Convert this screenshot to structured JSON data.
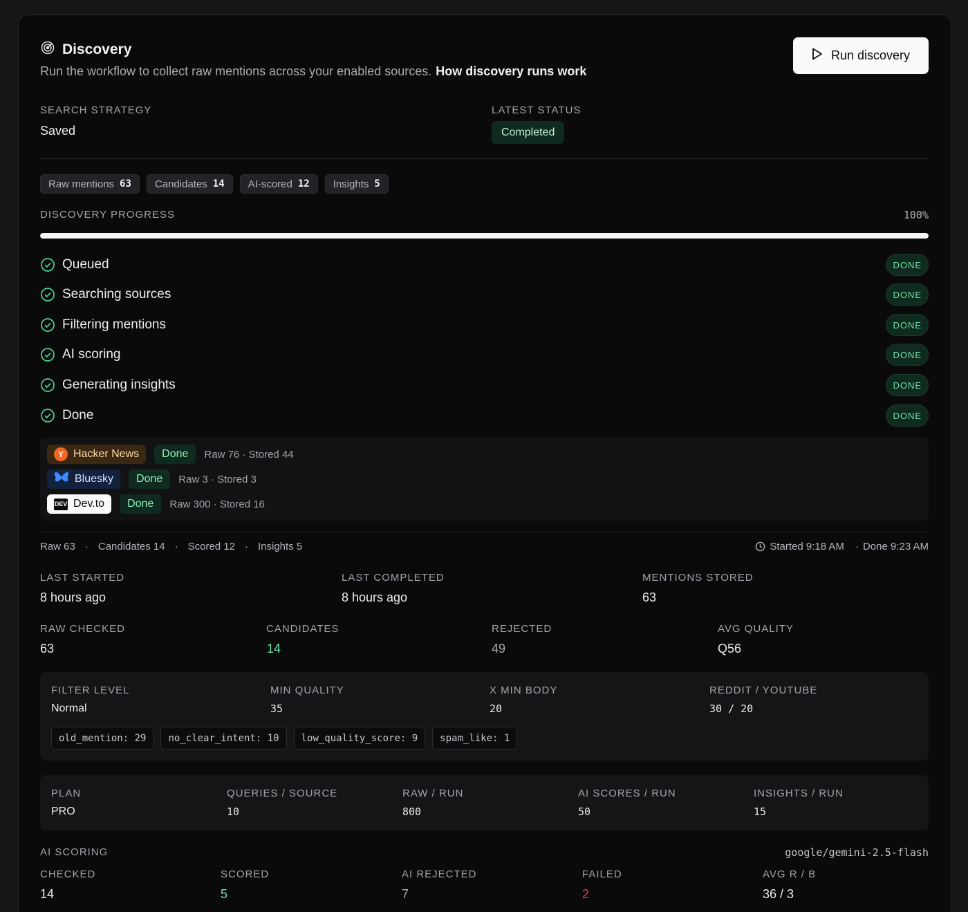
{
  "header": {
    "title": "Discovery",
    "subtitle": "Run the workflow to collect raw mentions across your enabled sources.",
    "help_link": "How discovery runs work",
    "run_button": "Run discovery"
  },
  "strategy": {
    "label": "SEARCH STRATEGY",
    "value": "Saved"
  },
  "latest_status": {
    "label": "LATEST STATUS",
    "value": "Completed"
  },
  "counts": [
    {
      "label": "Raw mentions",
      "value": "63"
    },
    {
      "label": "Candidates",
      "value": "14"
    },
    {
      "label": "AI-scored",
      "value": "12"
    },
    {
      "label": "Insights",
      "value": "5"
    }
  ],
  "progress": {
    "label": "DISCOVERY PROGRESS",
    "percent_text": "100%",
    "value": 1.0
  },
  "steps": [
    {
      "label": "Queued",
      "status": "DONE"
    },
    {
      "label": "Searching sources",
      "status": "DONE"
    },
    {
      "label": "Filtering mentions",
      "status": "DONE"
    },
    {
      "label": "AI scoring",
      "status": "DONE"
    },
    {
      "label": "Generating insights",
      "status": "DONE"
    },
    {
      "label": "Done",
      "status": "DONE"
    }
  ],
  "sources": [
    {
      "name": "Hacker News",
      "icon": "hacker-news-icon",
      "icon_text": "Y",
      "status": "Done",
      "meta": "Raw 76 · Stored 44"
    },
    {
      "name": "Bluesky",
      "icon": "butterfly-icon",
      "status": "Done",
      "meta": "Raw 3 · Stored 3"
    },
    {
      "name": "Dev.to",
      "icon": "dev-icon",
      "icon_text": "DEV",
      "status": "Done",
      "meta": "Raw 300 · Stored 16"
    }
  ],
  "summary": {
    "raw": "Raw 63",
    "candidates": "Candidates 14",
    "scored": "Scored 12",
    "insights": "Insights 5",
    "started": "Started 9:18 AM",
    "done": "Done 9:23 AM",
    "sep": "·"
  },
  "timing": [
    {
      "label": "LAST STARTED",
      "value": "8 hours ago"
    },
    {
      "label": "LAST COMPLETED",
      "value": "8 hours ago"
    },
    {
      "label": "MENTIONS STORED",
      "value": "63"
    }
  ],
  "stats": [
    {
      "label": "RAW CHECKED",
      "value": "63"
    },
    {
      "label": "CANDIDATES",
      "value": "14"
    },
    {
      "label": "REJECTED",
      "value": "49"
    },
    {
      "label": "AVG QUALITY",
      "value": "Q56"
    }
  ],
  "filters": {
    "items": [
      {
        "label": "FILTER LEVEL",
        "value": "Normal"
      },
      {
        "label": "MIN QUALITY",
        "value": "35"
      },
      {
        "label": "X MIN BODY",
        "value": "20"
      },
      {
        "label": "REDDIT / YOUTUBE",
        "value": "30 / 20"
      }
    ],
    "reasons": [
      "old_mention: 29",
      "no_clear_intent: 10",
      "low_quality_score: 9",
      "spam_like: 1"
    ]
  },
  "plan": [
    {
      "label": "PLAN",
      "value": "PRO"
    },
    {
      "label": "QUERIES / SOURCE",
      "value": "10"
    },
    {
      "label": "RAW / RUN",
      "value": "800"
    },
    {
      "label": "AI SCORES / RUN",
      "value": "50"
    },
    {
      "label": "INSIGHTS / RUN",
      "value": "15"
    }
  ],
  "ai_scoring": {
    "label": "AI SCORING",
    "model": "google/gemini-2.5-flash",
    "items": [
      {
        "label": "CHECKED",
        "value": "14"
      },
      {
        "label": "SCORED",
        "value": "5"
      },
      {
        "label": "AI REJECTED",
        "value": "7"
      },
      {
        "label": "FAILED",
        "value": "2"
      },
      {
        "label": "AVG R / B",
        "value": "36 / 3"
      }
    ]
  },
  "colors": {
    "accent_green": "#6fe0a6",
    "failed_red": "#d9423a",
    "background": "#0a0a0b"
  }
}
